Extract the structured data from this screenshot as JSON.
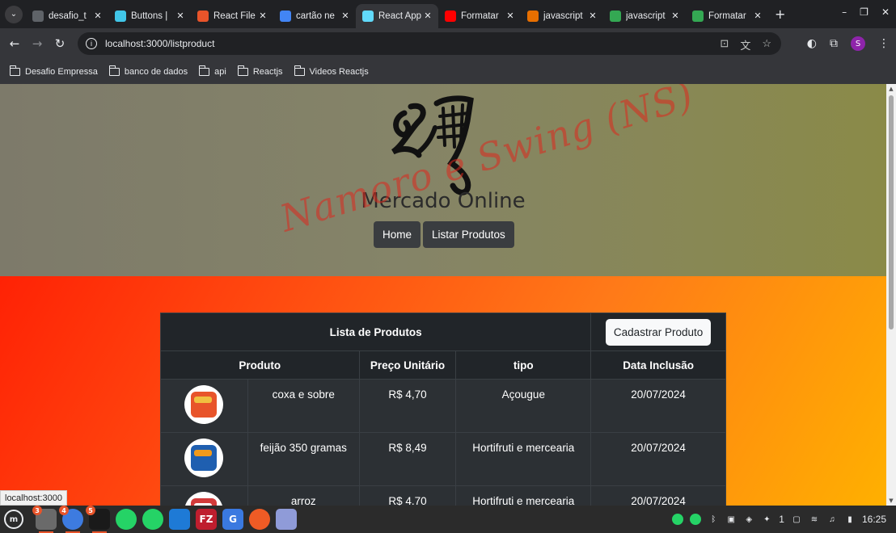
{
  "browser": {
    "tabs": [
      {
        "title": "desafio_t",
        "favicon": "globe-icon",
        "color": "#5f6368",
        "active": false
      },
      {
        "title": "Buttons |",
        "favicon": "react-bootstrap-icon",
        "color": "#41c6e8",
        "active": false
      },
      {
        "title": "React File",
        "favicon": "doc-icon",
        "color": "#e8542a",
        "active": false
      },
      {
        "title": "cartão ne",
        "favicon": "google-icon",
        "color": "#4285f4",
        "active": false
      },
      {
        "title": "React App",
        "favicon": "react-icon",
        "color": "#61dafb",
        "active": true
      },
      {
        "title": "Formatar",
        "favicon": "youtube-icon",
        "color": "#ff0000",
        "active": false
      },
      {
        "title": "javascript",
        "favicon": "java-icon",
        "color": "#e76f00",
        "active": false
      },
      {
        "title": "javascript",
        "favicon": "sheets-icon",
        "color": "#34a853",
        "active": false
      },
      {
        "title": "Formatar",
        "favicon": "sheets-icon",
        "color": "#34a853",
        "active": false
      }
    ],
    "new_tab": "+",
    "url": "localhost:3000/listproduct",
    "profile_initial": "S",
    "bookmarks": [
      "Desafio Empressa",
      "banco de dados",
      "api",
      "Reactjs",
      "Videos Reactjs"
    ],
    "status_url": "localhost:3000"
  },
  "page": {
    "site_title": "Mercado Online",
    "watermark": "Namoro e Swing (NS)",
    "nav": [
      "Home",
      "Listar Produtos"
    ],
    "table": {
      "caption": "Lista de Produtos",
      "add_button": "Cadastrar Produto",
      "headers": [
        "Produto",
        "Preço Unitário",
        "tipo",
        "Data Inclusão"
      ],
      "rows": [
        {
          "name": "coxa e sobre",
          "price": "R$ 4,70",
          "type": "Açougue",
          "date": "20/07/2024",
          "img_color": "#e8542a",
          "img_color2": "#f0c040"
        },
        {
          "name": "feijão 350 gramas",
          "price": "R$ 8,49",
          "type": "Hortifruti e mercearia",
          "date": "20/07/2024",
          "img_color": "#1f5fb0",
          "img_color2": "#f29a1b"
        },
        {
          "name": "arroz",
          "price": "R$ 4.70",
          "type": "Hortifruti e mercearia",
          "date": "20/07/2024",
          "img_color": "#d23a3a",
          "img_color2": "#ffffff"
        }
      ]
    }
  },
  "taskbar": {
    "apps": [
      {
        "name": "files",
        "badge": "3",
        "color": "#6a6a6a",
        "glyph": ""
      },
      {
        "name": "chrome",
        "badge": "4",
        "color": "#3d7be0",
        "glyph": ""
      },
      {
        "name": "terminal",
        "badge": "5",
        "color": "#1a1a1a",
        "glyph": ""
      },
      {
        "name": "whatsapp",
        "badge": "",
        "color": "#25d366",
        "glyph": ""
      },
      {
        "name": "whatsapp-2",
        "badge": "",
        "color": "#25d366",
        "glyph": ""
      },
      {
        "name": "vscode",
        "badge": "",
        "color": "#1e7ad6",
        "glyph": ""
      },
      {
        "name": "filezilla",
        "badge": "",
        "color": "#bf1e2e",
        "glyph": "FZ"
      },
      {
        "name": "google-app",
        "badge": "",
        "color": "#3a79e0",
        "glyph": "G"
      },
      {
        "name": "postman",
        "badge": "",
        "color": "#ef5b25",
        "glyph": ""
      },
      {
        "name": "text-editor",
        "badge": "",
        "color": "#8f9bd8",
        "glyph": ""
      }
    ],
    "tray_count": "1",
    "clock": "16:25"
  }
}
